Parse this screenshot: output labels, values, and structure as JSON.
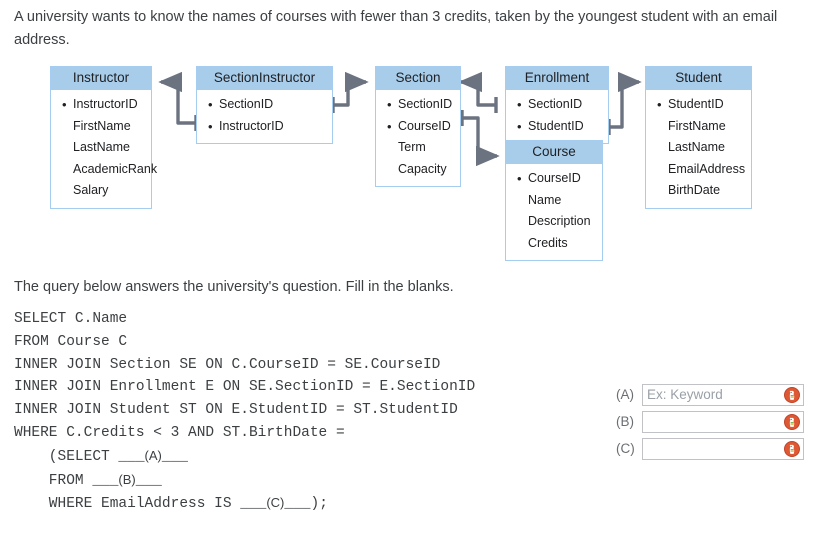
{
  "prompt": {
    "text": "A university wants to know the names of courses with fewer than 3 credits, taken by the youngest student with an email address."
  },
  "er_diagram": {
    "tables": [
      {
        "name": "Instructor",
        "title": "Instructor",
        "fields": [
          {
            "label": "InstructorID",
            "key": true
          },
          {
            "label": "FirstName",
            "key": false
          },
          {
            "label": "LastName",
            "key": false
          },
          {
            "label": "AcademicRank",
            "key": false
          },
          {
            "label": "Salary",
            "key": false
          }
        ]
      },
      {
        "name": "SectionInstructor",
        "title": "SectionInstructor",
        "fields": [
          {
            "label": "SectionID",
            "key": true
          },
          {
            "label": "InstructorID",
            "key": true
          }
        ]
      },
      {
        "name": "Section",
        "title": "Section",
        "fields": [
          {
            "label": "SectionID",
            "key": true
          },
          {
            "label": "CourseID",
            "key": true
          },
          {
            "label": "Term",
            "key": false
          },
          {
            "label": "Capacity",
            "key": false
          }
        ]
      },
      {
        "name": "Enrollment",
        "title": "Enrollment",
        "fields": [
          {
            "label": "SectionID",
            "key": true
          },
          {
            "label": "StudentID",
            "key": true
          }
        ]
      },
      {
        "name": "Student",
        "title": "Student",
        "fields": [
          {
            "label": "StudentID",
            "key": true
          },
          {
            "label": "FirstName",
            "key": false
          },
          {
            "label": "LastName",
            "key": false
          },
          {
            "label": "EmailAddress",
            "key": false
          },
          {
            "label": "BirthDate",
            "key": false
          }
        ]
      },
      {
        "name": "Course",
        "title": "Course",
        "fields": [
          {
            "label": "CourseID",
            "key": true
          },
          {
            "label": "Name",
            "key": false
          },
          {
            "label": "Description",
            "key": false
          },
          {
            "label": "Credits",
            "key": false
          }
        ]
      }
    ],
    "relationships": [
      {
        "from": "SectionInstructor",
        "to": "Instructor"
      },
      {
        "from": "SectionInstructor",
        "to": "Section"
      },
      {
        "from": "Enrollment",
        "to": "Section"
      },
      {
        "from": "Enrollment",
        "to": "Student"
      },
      {
        "from": "Section",
        "to": "Course"
      }
    ],
    "colors": {
      "header_fill": "#a8cdeb",
      "border": "#a4cdf0",
      "connector": "#6b7280"
    }
  },
  "query_section": {
    "intro": "The query below answers the university's question. Fill in the blanks.",
    "sql_lines": [
      "SELECT C.Name",
      "FROM Course C",
      "INNER JOIN Section SE ON C.CourseID = SE.CourseID",
      "INNER JOIN Enrollment E ON SE.SectionID = E.SectionID",
      "INNER JOIN Student ST ON E.StudentID = ST.StudentID",
      "WHERE C.Credits < 3 AND ST.BirthDate =",
      "    (SELECT ___(A)___",
      "    FROM ___(B)___",
      "    WHERE EmailAddress IS ___(C)___);"
    ]
  },
  "answers": {
    "fields": [
      {
        "label": "(A)",
        "value": "",
        "placeholder": "Ex: Keyword",
        "icon": "duckduckgo-icon"
      },
      {
        "label": "(B)",
        "value": "",
        "placeholder": "",
        "icon": "duckduckgo-icon"
      },
      {
        "label": "(C)",
        "value": "",
        "placeholder": "",
        "icon": "duckduckgo-icon"
      }
    ]
  }
}
